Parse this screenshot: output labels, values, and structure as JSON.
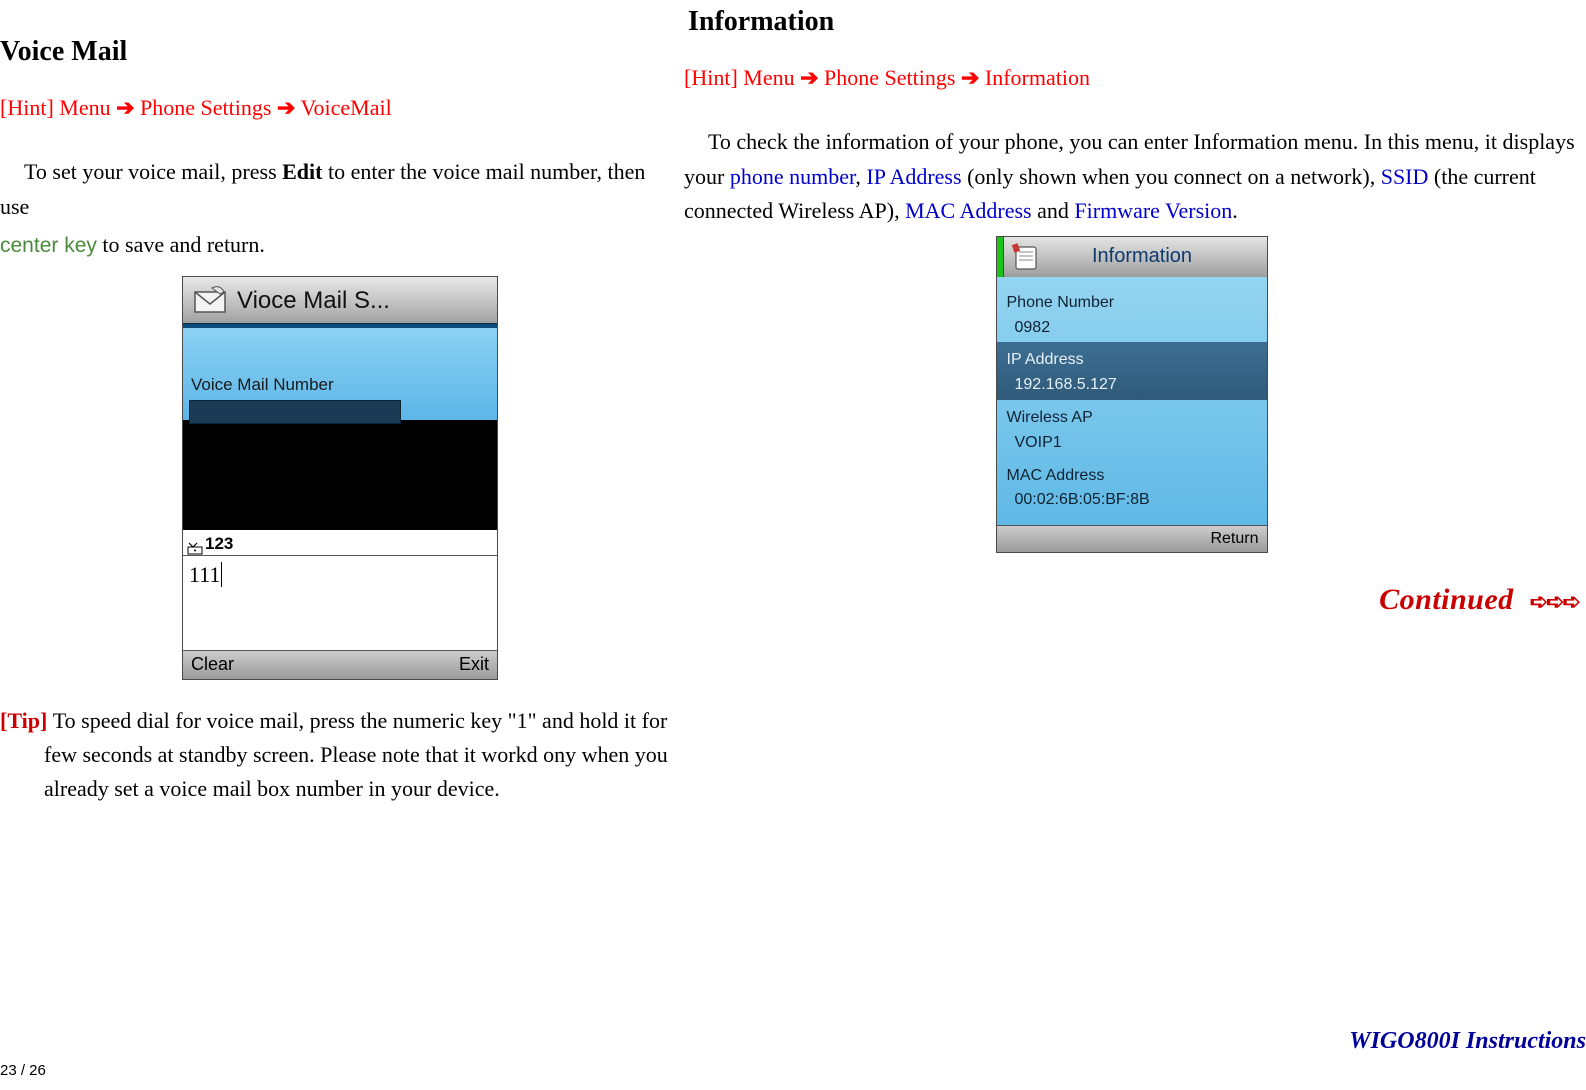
{
  "left": {
    "heading": "Voice Mail",
    "hint": {
      "prefix": "[Hint] Menu ",
      "arrow": "➔",
      "mid": " Phone Settings ",
      "last": " VoiceMail"
    },
    "para1": {
      "pre": "To set your voice mail, press ",
      "bold": "Edit",
      "post": " to enter the voice mail number, then use "
    },
    "para1b": {
      "key": "center key",
      "post": " to save and return."
    },
    "phone": {
      "title": "Vioce Mail S...",
      "field_label": "Voice Mail Number",
      "input_mode": "123",
      "input_value": "111",
      "soft_left": "Clear",
      "soft_right": "Exit"
    },
    "tip": {
      "label": "[Tip] ",
      "line1": "To speed dial for voice mail, press the numeric key \"1\" and hold it for",
      "line2": "few seconds at standby screen. Please note that it workd ony when you",
      "line3": "already set a voice mail box number in your device."
    }
  },
  "right": {
    "heading": "Information",
    "hint": {
      "prefix": "[Hint] Menu ",
      "arrow": "➔",
      "mid": " Phone Settings ",
      "last": " Information"
    },
    "para_pre": "To check the information of your phone, you can enter Information menu. In this menu, it displays your ",
    "term1": "phone number",
    "sep1": ", ",
    "term2": "IP Address",
    "post2": " (only shown when you connect on a network), ",
    "term3": "SSID",
    "post3": " (the current connected Wireless AP), ",
    "term4": "MAC Address",
    "and": " and ",
    "term5": "Firmware Version",
    "period": ".",
    "phone": {
      "title": "Information",
      "rows": [
        {
          "label": "Phone Number",
          "value": "0982"
        },
        {
          "label": "IP Address",
          "value": "192.168.5.127"
        },
        {
          "label": "Wireless AP",
          "value": "VOIP1"
        },
        {
          "label": "MAC Address",
          "value": "00:02:6B:05:BF:8B"
        }
      ],
      "soft_right": "Return"
    },
    "continued": "Continued",
    "continued_arrows": "➪➪➪"
  },
  "footer": {
    "product": "WIGO800I Instructions",
    "page": "23 / 26"
  }
}
